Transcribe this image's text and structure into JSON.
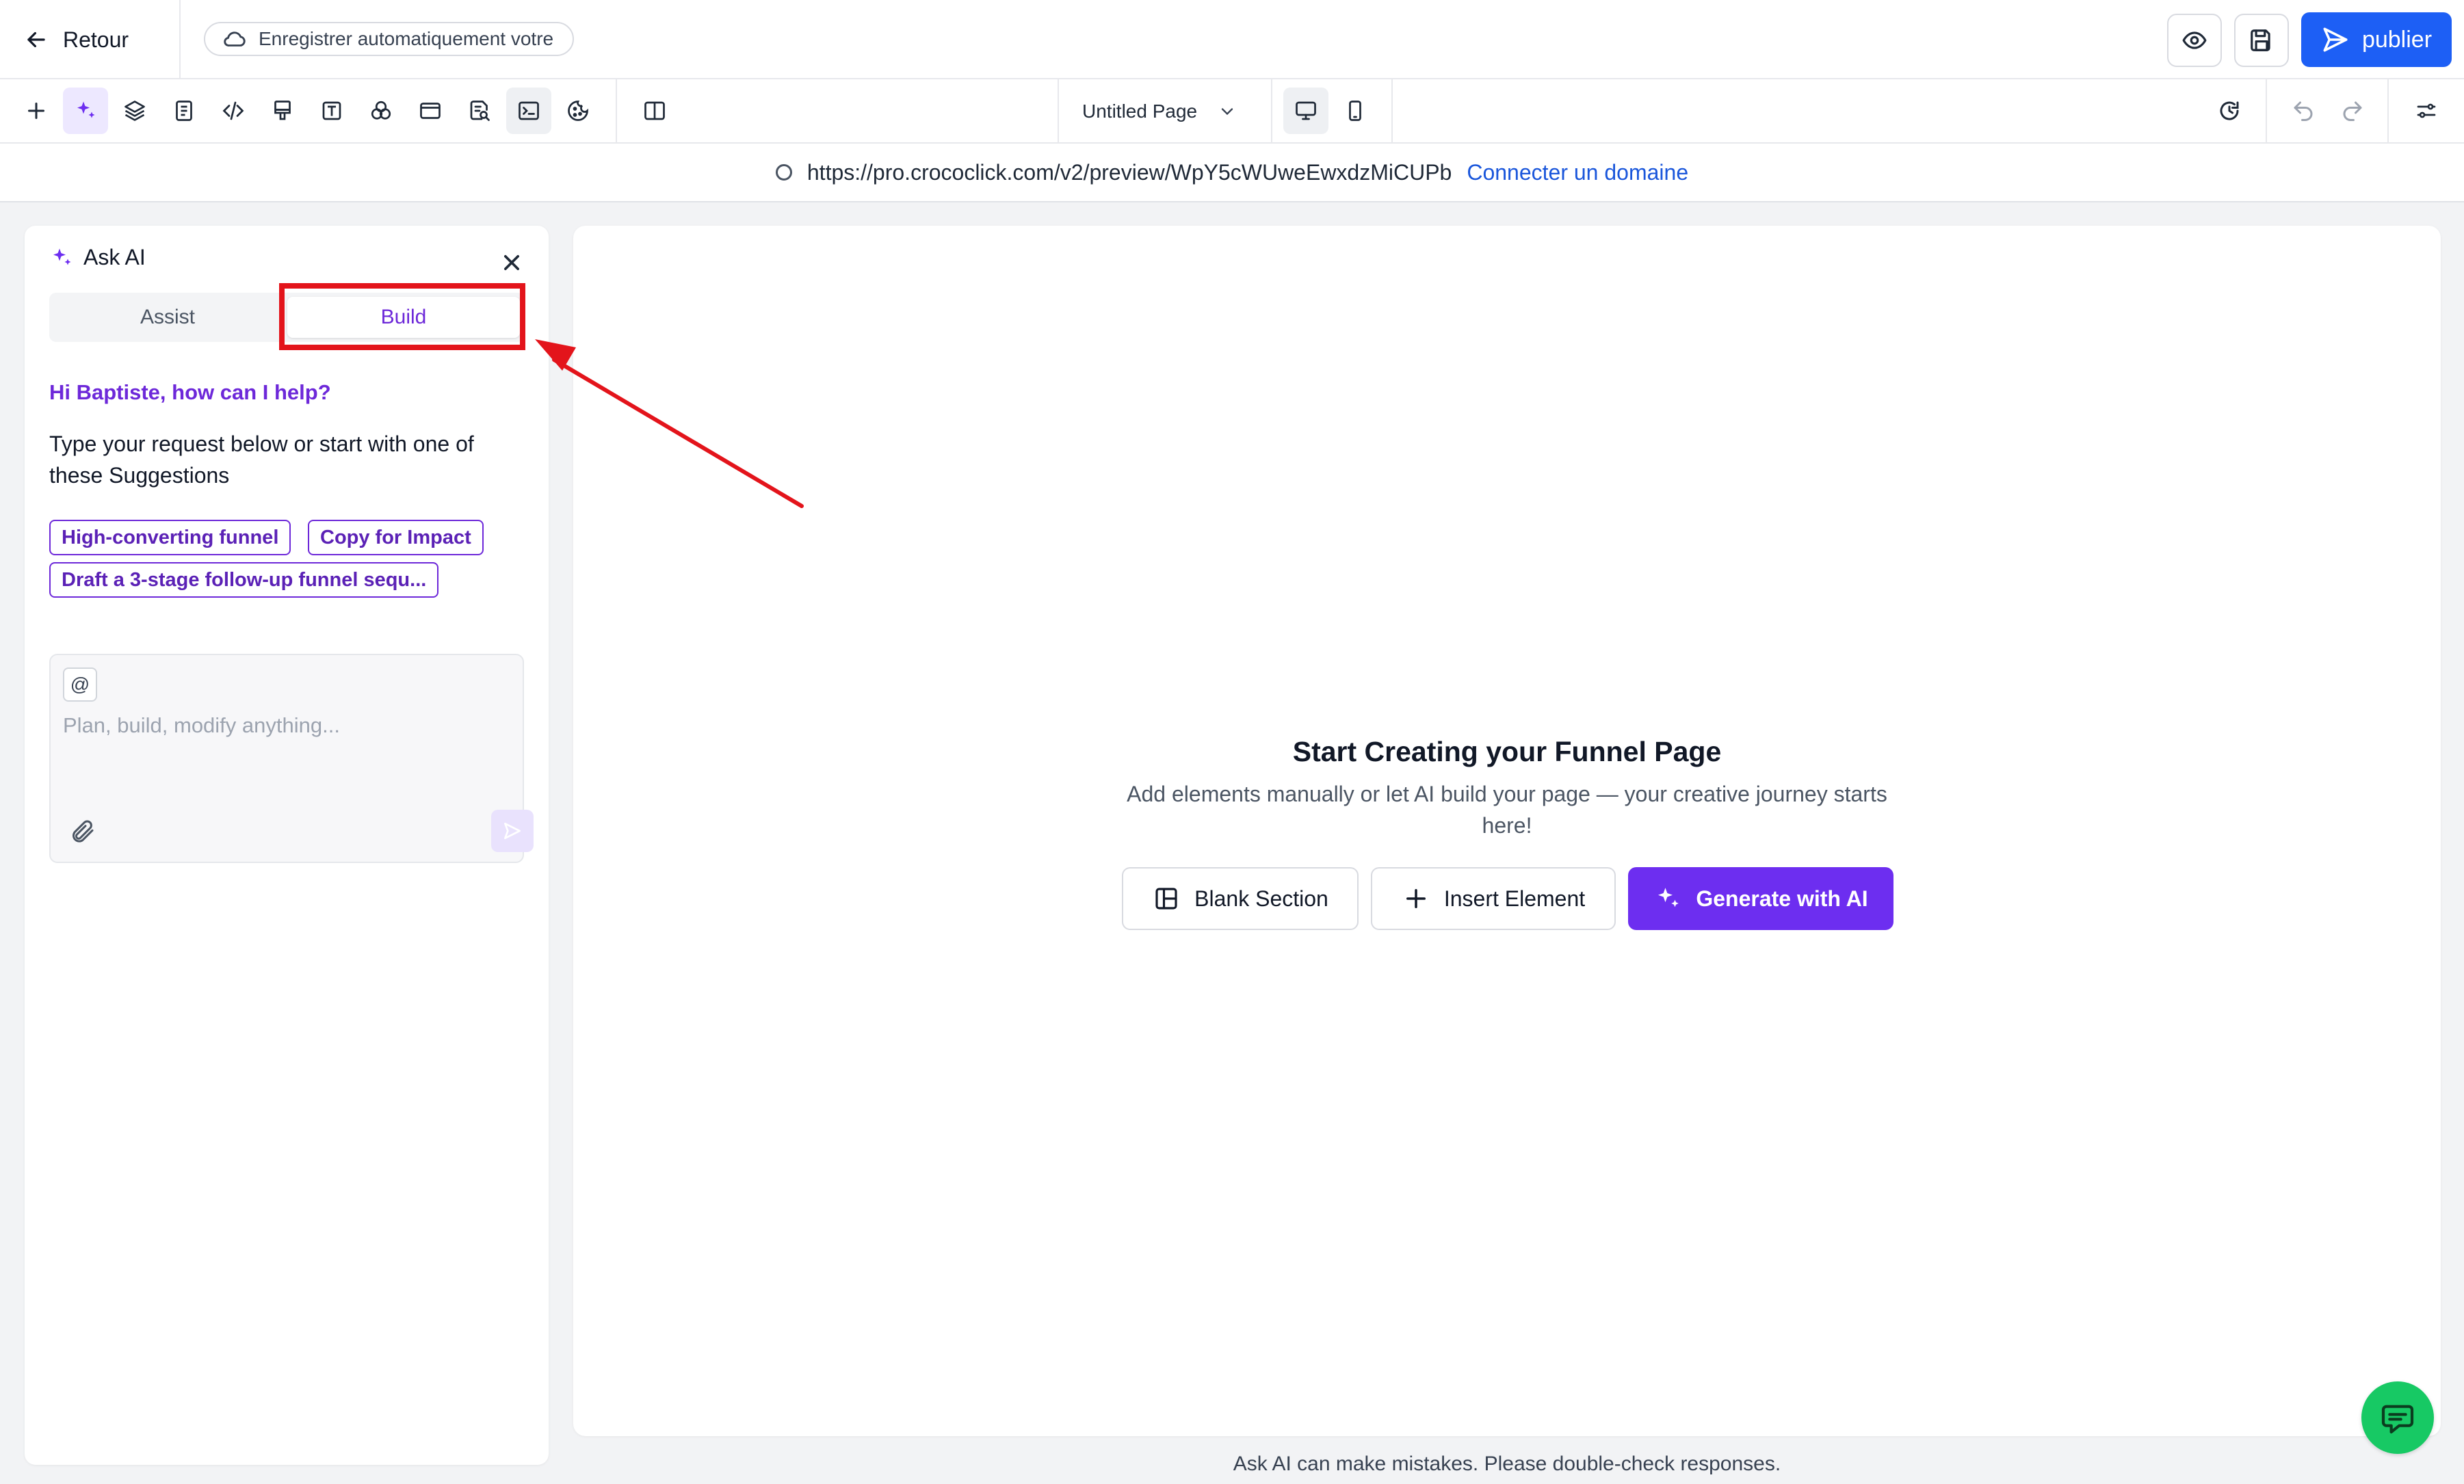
{
  "topbar": {
    "back_label": "Retour",
    "autosave_label": "Enregistrer automatiquement votre",
    "publish_label": "publier"
  },
  "toolbar": {
    "page_select": "Untitled Page",
    "tools": [
      "add-icon",
      "sparkles-icon",
      "layers-icon",
      "page-icon",
      "code-icon",
      "brush-icon",
      "text-icon",
      "components-icon",
      "window-icon",
      "search-doc-icon",
      "terminal-icon",
      "cookie-icon",
      "split-view-icon"
    ],
    "active_tool": "sparkles-icon",
    "device": "desktop"
  },
  "urlbar": {
    "url": "https://pro.crococlick.com/v2/preview/WpY5cWUweEwxdzMiCUPb",
    "connect_domain": "Connecter un domaine"
  },
  "ai_panel": {
    "title": "Ask AI",
    "tabs": [
      {
        "label": "Assist",
        "selected": false
      },
      {
        "label": "Build",
        "selected": true
      }
    ],
    "greeting": "Hi Baptiste, how can I help?",
    "intro": "Type your request below or start with one of these Suggestions",
    "suggestions": [
      "High-converting funnel",
      "Copy for Impact",
      "Draft a 3-stage follow-up funnel sequ..."
    ],
    "composer": {
      "at_symbol": "@",
      "placeholder": "Plan, build, modify anything...",
      "value": ""
    }
  },
  "canvas": {
    "title": "Start Creating your Funnel Page",
    "description": "Add elements manually or let AI build your page — your creative journey starts here!",
    "buttons": {
      "blank_section": "Blank Section",
      "insert_element": "Insert Element",
      "generate_ai": "Generate with AI"
    }
  },
  "footer_note": "Ask AI can make mistakes. Please double-check responses.",
  "colors": {
    "brand_blue": "#1d5ff5",
    "ai_purple": "#6d2ef0",
    "chat_green": "#17c964",
    "annotation_red": "#e3141b"
  }
}
